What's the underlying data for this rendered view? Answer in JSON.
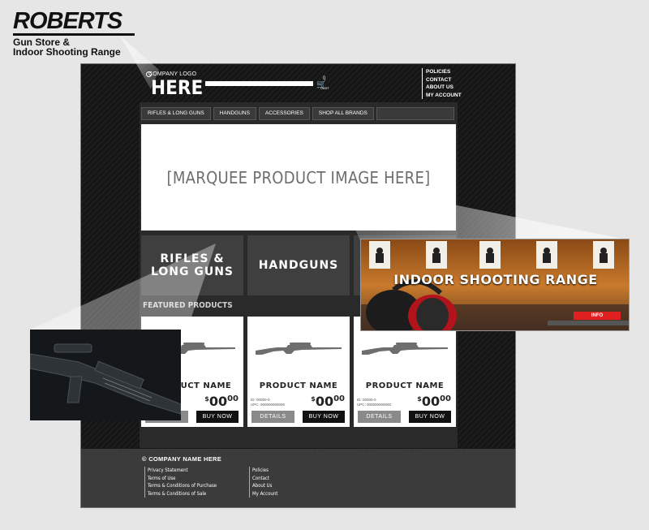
{
  "brand": {
    "title": "ROBERTS",
    "subtitle_line1": "Gun Store &",
    "subtitle_line2": "Indoor Shooting Range"
  },
  "header": {
    "logo_small": "COMPANY LOGO",
    "logo_big": "HERE",
    "cart_count": "0",
    "cart_label": "CART",
    "top_links": [
      "POLICIES",
      "CONTACT",
      "ABOUT US",
      "MY ACCOUNT"
    ]
  },
  "nav": {
    "tabs": [
      "RIFLES & LONG GUNS",
      "HANDGUNS",
      "ACCESSORIES",
      "SHOP ALL BRANDS"
    ]
  },
  "marquee": {
    "text": "[MARQUEE PRODUCT IMAGE HERE]"
  },
  "categories": {
    "rifles_line1": "RIFLES &",
    "rifles_line2": "LONG GUNS",
    "handguns": "HANDGUNS"
  },
  "featured": {
    "heading": "FEATURED PRODUCTS"
  },
  "products": [
    {
      "name": "PRODUCT NAME",
      "id": "ID: 00000-0",
      "upc": "UPC: 000000000000",
      "price_dollars": "00",
      "price_cents": "00",
      "details": "DETAILS",
      "buy": "BUY NOW"
    },
    {
      "name": "PRODUCT NAME",
      "id": "ID: 00000-0",
      "upc": "UPC: 000000000000",
      "price_dollars": "00",
      "price_cents": "00",
      "details": "DETAILS",
      "buy": "BUY NOW"
    },
    {
      "name": "PRODUCT NAME",
      "id": "ID: 00000-0",
      "upc": "UPC: 000000000000",
      "price_dollars": "00",
      "price_cents": "00",
      "details": "DETAILS",
      "buy": "BUY NOW"
    }
  ],
  "currency": "$",
  "callout": {
    "title": "INDOOR SHOOTING RANGE",
    "button": "INFO"
  },
  "footer": {
    "copyright": "© COMPANY NAME HERE",
    "col1": [
      "Privacy Statement",
      "Terms of Use",
      "Terms & Conditions of Purchase",
      "Terms & Conditions of Sale"
    ],
    "col2": [
      "Policies",
      "Contact",
      "About Us",
      "My Account"
    ]
  },
  "colors": {
    "accent": "#e02020",
    "frame": "#181818",
    "card": "#ffffff"
  }
}
